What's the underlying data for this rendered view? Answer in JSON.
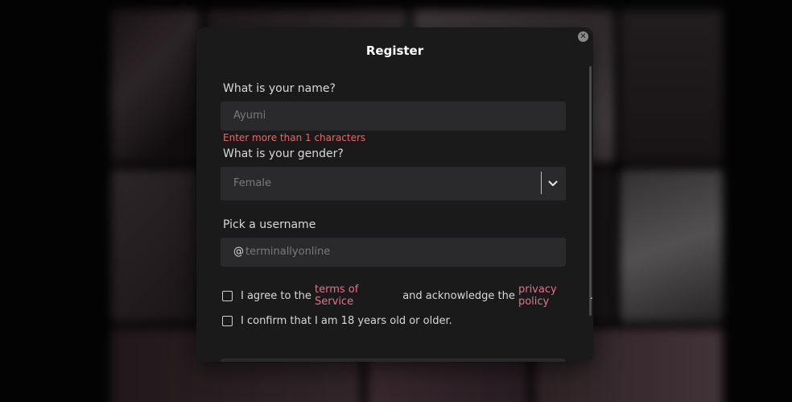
{
  "modal": {
    "title": "Register",
    "close_icon": "close-icon"
  },
  "name": {
    "label": "What is your name?",
    "placeholder": "Ayumi",
    "error": "Enter more than 1 characters"
  },
  "gender": {
    "label": "What is your gender?",
    "selected": "Female",
    "icon": "chevron-down-icon"
  },
  "username": {
    "label": "Pick a username",
    "prefix": "@",
    "placeholder": "terminallyonline"
  },
  "terms": {
    "text_before": "I agree to the ",
    "terms_link": "terms of Service",
    "text_middle": " and acknowledge the ",
    "privacy_link": "privacy policy",
    "text_after": ".",
    "checked": false
  },
  "age": {
    "text": "I confirm that I am 18 years old or older.",
    "checked": false
  },
  "colors": {
    "modal_bg": "#1a1a1b",
    "field_bg": "#2a2a2c",
    "error": "#e06a6a",
    "link": "#e0748c"
  }
}
